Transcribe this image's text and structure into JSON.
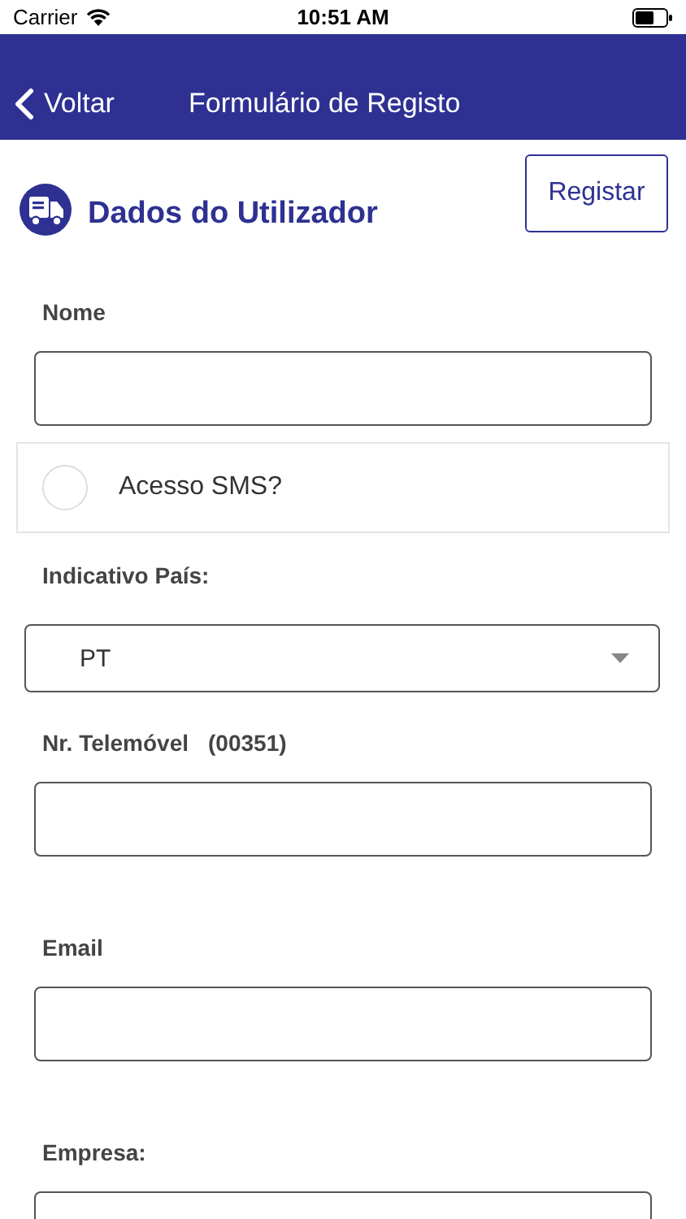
{
  "status_bar": {
    "carrier": "Carrier",
    "time": "10:51 AM"
  },
  "nav_bar": {
    "back_label": "Voltar",
    "title": "Formulário de Registo"
  },
  "section": {
    "title": "Dados do Utilizador"
  },
  "register_button": "Registar",
  "fields": [
    {
      "kind": "text",
      "label": "Nome"
    },
    {
      "kind": "checkbox",
      "label": "Acesso SMS?",
      "checked": false
    },
    {
      "kind": "select",
      "label": "Indicativo País:",
      "value": "PT"
    },
    {
      "kind": "text",
      "label": "Nr. Telemóvel",
      "hint": "(00351)"
    },
    {
      "kind": "text",
      "label": "Email"
    },
    {
      "kind": "text",
      "label": "Empresa:"
    }
  ]
}
